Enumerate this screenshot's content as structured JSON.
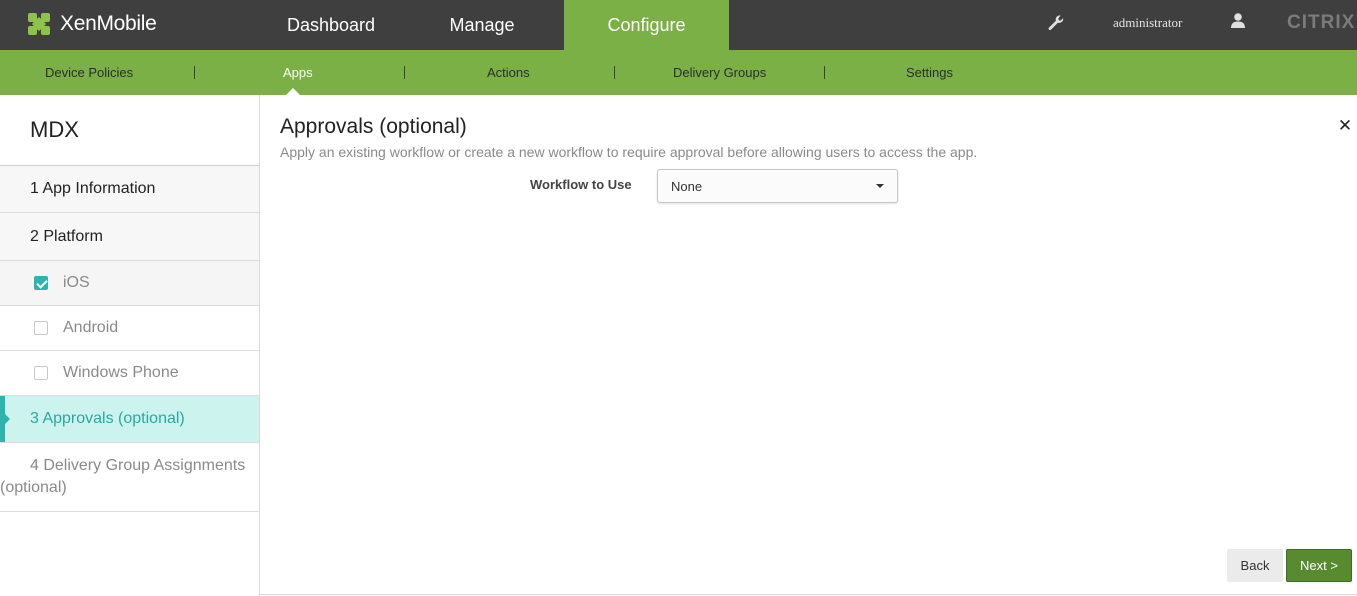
{
  "app": {
    "logo_text": "XenMobile",
    "brand": "CITRIX",
    "user": "administrator"
  },
  "main_nav": [
    {
      "label": "Dashboard"
    },
    {
      "label": "Manage"
    },
    {
      "label": "Configure",
      "active": true
    }
  ],
  "sub_nav": [
    {
      "label": "Device Policies"
    },
    {
      "label": "Apps",
      "active": true
    },
    {
      "label": "Actions"
    },
    {
      "label": "Delivery Groups"
    },
    {
      "label": "Settings"
    }
  ],
  "sidebar": {
    "title": "MDX",
    "steps": {
      "app_information": "1  App Information",
      "platform": "2  Platform",
      "approvals": "3  Approvals (optional)",
      "delivery_line1": "4  Delivery Group Assignments",
      "delivery_line2": "(optional)"
    },
    "platforms": [
      {
        "label": "iOS",
        "checked": true
      },
      {
        "label": "Android",
        "checked": false
      },
      {
        "label": "Windows Phone",
        "checked": false
      }
    ]
  },
  "content": {
    "title": "Approvals (optional)",
    "description": "Apply an existing workflow or create a new workflow to require approval before allowing users to access the app.",
    "close_glyph": "✕",
    "workflow_label": "Workflow to Use",
    "workflow_value": "None"
  },
  "buttons": {
    "back": "Back",
    "next": "Next >"
  },
  "colors": {
    "topbar": "#3f3f3f",
    "accent_green": "#7ab046",
    "active_teal": "#2fb3ad",
    "active_bg": "#cdf3ef",
    "next_button": "#588a30"
  }
}
